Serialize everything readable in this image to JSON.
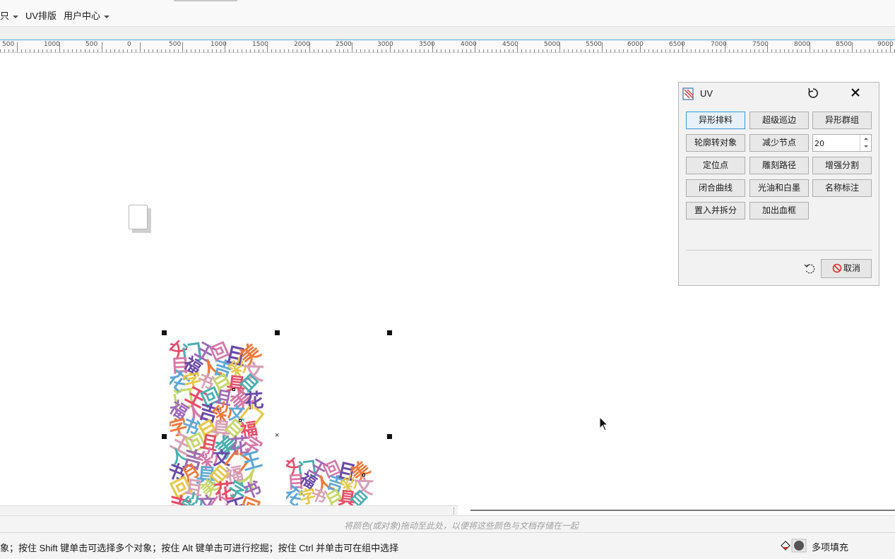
{
  "menu": {
    "items": [
      {
        "label": "只",
        "has_caret": true
      },
      {
        "label": "UV排版",
        "has_caret": false
      },
      {
        "label": "用户中心",
        "has_caret": true
      }
    ]
  },
  "ruler": {
    "labels": [
      "500",
      "1000",
      "500",
      "0",
      "500",
      "1000",
      "1500",
      "2000",
      "2500",
      "3000",
      "3500",
      "4000",
      "4500",
      "5000",
      "5500",
      "6000",
      "6500",
      "7000",
      "7500",
      "8000",
      "8500",
      "9000"
    ]
  },
  "uv_panel": {
    "title": "UV",
    "logo_icon": "uv-logo-icon",
    "buttons": {
      "shaped_nesting": "异形排料",
      "super_outline": "超级巡边",
      "shaped_group": "异形群组",
      "contour_to_object": "轮廓转对象",
      "reduce_nodes": "减少节点",
      "locate_points": "定位点",
      "engrave_path": "雕刻路径",
      "enhanced_split": "增强分割",
      "close_curve": "闭合曲线",
      "varnish_white_ink": "光油和白墨",
      "name_label": "名称标注",
      "place_and_split": "置入并拆分",
      "add_bleed_frame": "加出血框"
    },
    "spin_value": "20",
    "cancel_label": "取消",
    "colors": {
      "focus_border": "#3c97d8",
      "cancel_icon": "#d9352a"
    }
  },
  "palette": {
    "hint": "将颜色(或对象)拖动至此处，以便将这些颜色与文档存储在一起"
  },
  "status": {
    "message": "象；按住 Shift 键单击可选择多个对象；按住 Alt 键单击可进行挖掘；按住 Ctrl 并单击可在组中选择",
    "fill_label": "多项填充"
  }
}
